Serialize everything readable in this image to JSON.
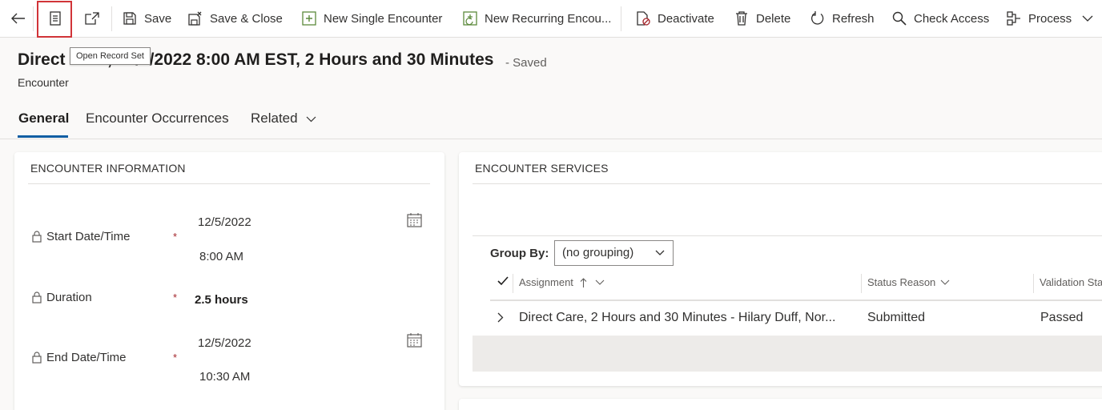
{
  "toolbar": {
    "save": "Save",
    "save_close": "Save & Close",
    "new_single": "New Single Encounter",
    "new_recurring": "New Recurring Encou...",
    "deactivate": "Deactivate",
    "delete": "Delete",
    "refresh": "Refresh",
    "check_access": "Check Access",
    "process": "Process"
  },
  "tooltip": "Open Record Set",
  "header": {
    "title": "Direct Care, 12/5/2022 8:00 AM EST, 2 Hours and 30 Minutes",
    "saved_status": "- Saved",
    "entity": "Encounter"
  },
  "tabs": {
    "general": "General",
    "occurrences": "Encounter Occurrences",
    "related": "Related"
  },
  "info_section": {
    "title": "ENCOUNTER INFORMATION",
    "required_mark": "*",
    "start_label": "Start Date/Time",
    "start_date": "12/5/2022",
    "start_time": "8:00 AM",
    "duration_label": "Duration",
    "duration_value": "2.5 hours",
    "end_label": "End Date/Time",
    "end_date": "12/5/2022",
    "end_time": "10:30 AM"
  },
  "services_section": {
    "title": "ENCOUNTER SERVICES",
    "group_by_label": "Group By:",
    "group_by_value": "(no grouping)",
    "columns": {
      "assignment": "Assignment",
      "status_reason": "Status Reason",
      "validation": "Validation Sta"
    },
    "rows": [
      {
        "assignment": "Direct Care, 2 Hours and 30 Minutes - Hilary Duff, Nor...",
        "status_reason": "Submitted",
        "validation": "Passed"
      }
    ]
  }
}
